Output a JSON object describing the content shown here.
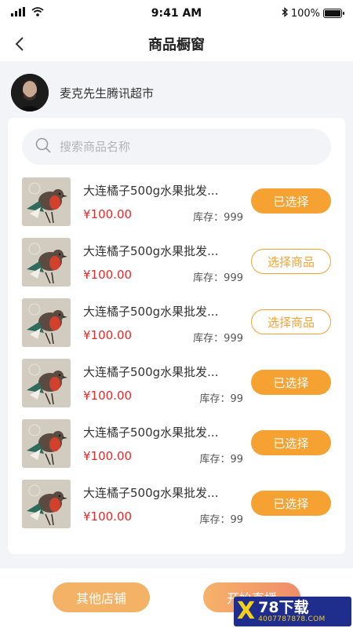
{
  "status": {
    "time": "9:41 AM",
    "battery": "100%",
    "battery_level": 1.0
  },
  "nav": {
    "title": "商品橱窗"
  },
  "shop": {
    "name": "麦克先生腾讯超市"
  },
  "search": {
    "placeholder": "搜索商品名称"
  },
  "products": [
    {
      "name": "大连橘子500g水果批发...",
      "price": "¥100.00",
      "stock": "库存：999",
      "button": "已选择",
      "selected": true
    },
    {
      "name": "大连橘子500g水果批发...",
      "price": "¥100.00",
      "stock": "库存：999",
      "button": "选择商品",
      "selected": false
    },
    {
      "name": "大连橘子500g水果批发...",
      "price": "¥100.00",
      "stock": "库存：999",
      "button": "选择商品",
      "selected": false
    },
    {
      "name": "大连橘子500g水果批发...",
      "price": "¥100.00",
      "stock": "库存：99",
      "button": "已选择",
      "selected": true
    },
    {
      "name": "大连橘子500g水果批发...",
      "price": "¥100.00",
      "stock": "库存：99",
      "button": "已选择",
      "selected": true
    },
    {
      "name": "大连橘子500g水果批发...",
      "price": "¥100.00",
      "stock": "库存：99",
      "button": "已选择",
      "selected": true
    }
  ],
  "footer": {
    "other_label": "其他店铺",
    "live_label": "开始直播"
  },
  "watermark": {
    "logo": "X",
    "title": "78下载",
    "phone": "4007787878.COM"
  },
  "colors": {
    "accent": "#f6a233",
    "price": "#e32b2b",
    "background": "#f3f4f8"
  }
}
